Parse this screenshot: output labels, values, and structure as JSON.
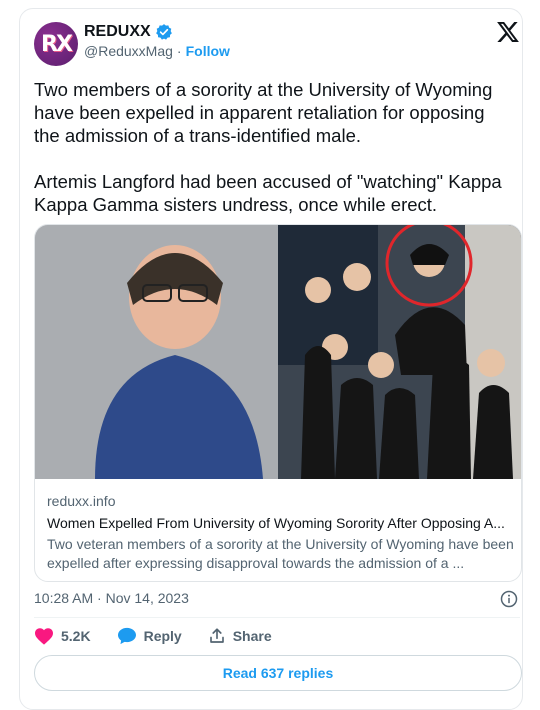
{
  "account": {
    "avatar_text": "RX",
    "display_name": "REDUXX",
    "handle": "@ReduxxMag",
    "separator": "·",
    "follow_label": "Follow"
  },
  "tweet": {
    "paragraphs": [
      "Two members of a sorority at the University of Wyoming have been expelled in apparent retaliation for opposing the admission of a trans-identified male.",
      "Artemis Langford had been accused of \"watching\" Kappa Kappa Gamma sisters undress, once while erect."
    ]
  },
  "link_card": {
    "domain": "reduxx.info",
    "title": "Women Expelled From University of Wyoming Sorority After Opposing A...",
    "description": "Two veteran members of a sorority at the University of Wyoming have been expelled after expressing disapproval towards the admission of a ..."
  },
  "meta": {
    "timestamp": "10:28 AM · Nov 14, 2023"
  },
  "actions": {
    "like_count": "5.2K",
    "reply_label": "Reply",
    "share_label": "Share"
  },
  "read_replies_label": "Read 637 replies",
  "colors": {
    "accent": "#1d9bf0",
    "like": "#f91880",
    "text": "#0f1419",
    "muted": "#536471",
    "highlight_circle": "#e0262b"
  },
  "icons": [
    "verified-badge-icon",
    "x-logo-icon",
    "info-icon",
    "heart-icon",
    "reply-bubble-icon",
    "share-icon"
  ]
}
